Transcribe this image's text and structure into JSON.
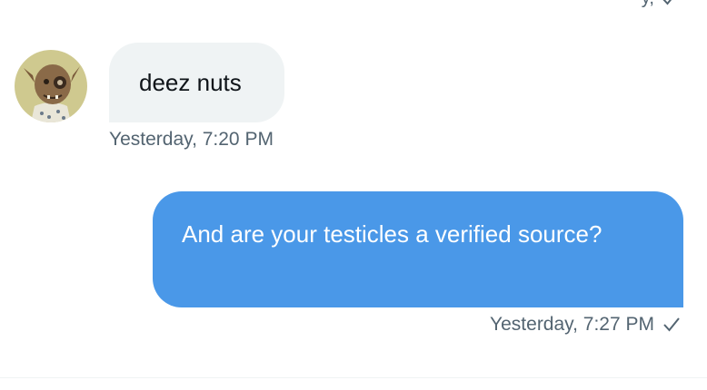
{
  "messages": [
    {
      "direction": "incoming",
      "text": "deez nuts",
      "timestamp": "Yesterday, 7:20 PM",
      "avatar_icon": "user-avatar-icon"
    },
    {
      "direction": "outgoing",
      "text": "And are your testicles a verified source?",
      "timestamp": "Yesterday, 7:27 PM",
      "status_icon": "check-icon"
    }
  ],
  "colors": {
    "incoming_bubble": "#eff3f4",
    "outgoing_bubble": "#4a98e8",
    "meta_text": "#536471"
  }
}
